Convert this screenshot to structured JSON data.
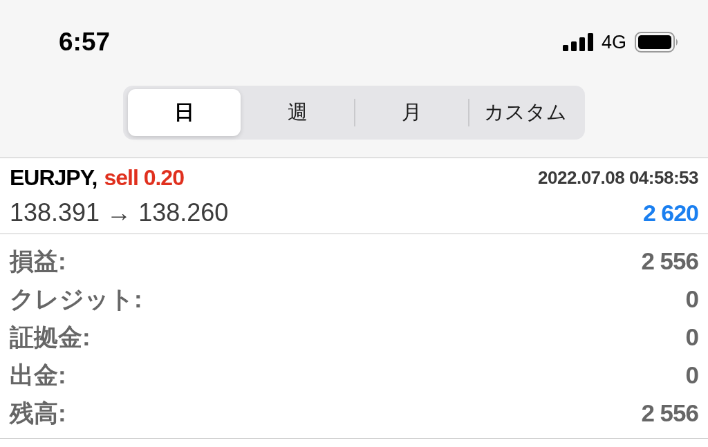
{
  "status_bar": {
    "time": "6:57",
    "network": "4G"
  },
  "period_tabs": [
    {
      "label": "日",
      "selected": true
    },
    {
      "label": "週",
      "selected": false
    },
    {
      "label": "月",
      "selected": false
    },
    {
      "label": "カスタム",
      "selected": false
    }
  ],
  "trade": {
    "symbol": "EURJPY,",
    "kind": "sell",
    "side": "sell 0.20",
    "time": "2022.07.08 04:58:53",
    "prices": "138.391 → 138.260",
    "profit": "2 620"
  },
  "summary": [
    {
      "label": "損益:",
      "value": "2 556"
    },
    {
      "label": "クレジット:",
      "value": "0"
    },
    {
      "label": "証拠金:",
      "value": "0"
    },
    {
      "label": "出金:",
      "value": "0"
    },
    {
      "label": "残高:",
      "value": "2 556"
    }
  ]
}
